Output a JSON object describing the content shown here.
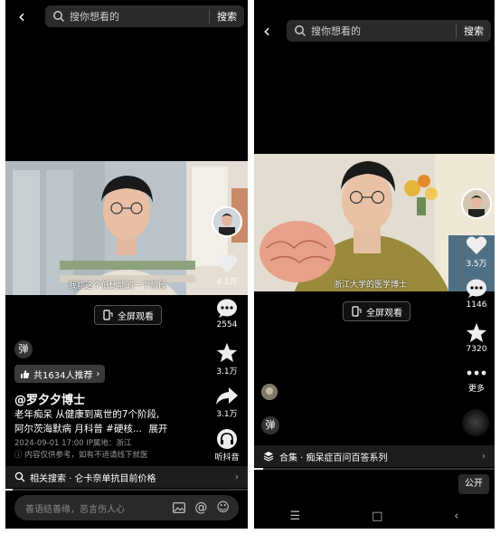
{
  "left": {
    "search": {
      "placeholder": "搜你想看的",
      "button": "搜索"
    },
    "caption": "我能这个低比能的一个阶段",
    "fullscreen": "全屏观看",
    "likes": "4.2万",
    "comments": "2554",
    "favorites": "3.1万",
    "shares": "3.1万",
    "listen": "听抖音",
    "danmu": "弹",
    "recommend": "共1634人推荐",
    "author": "@罗夕夕博士",
    "desc_line1": "老年痴呆 从健康到离世的7个阶段,",
    "desc_line2": "阿尔茨海默病 月科普 #硬核...",
    "expand": "展开",
    "meta": "2024-09-01 17:00  IP属地：浙江",
    "notice": "内容仅供参考，如有不适请线下就医",
    "related": "相关搜索 · 仑卡奈单抗目前价格",
    "comment_placeholder": "善语结善缘，恶言伤人心"
  },
  "right": {
    "search": {
      "placeholder": "搜你想看的",
      "button": "搜索"
    },
    "caption": "浙江大学的医学博士",
    "fullscreen": "全屏观看",
    "likes": "3.5万",
    "comments": "1146",
    "favorites": "7320",
    "more": "更多",
    "danmu": "弹",
    "collection": "合集 · 痴呆症百问百答系列",
    "open": "公开"
  },
  "colors": {
    "background": "#000000",
    "searchbar": "#2a2a2a",
    "accent": "#ffffff"
  }
}
